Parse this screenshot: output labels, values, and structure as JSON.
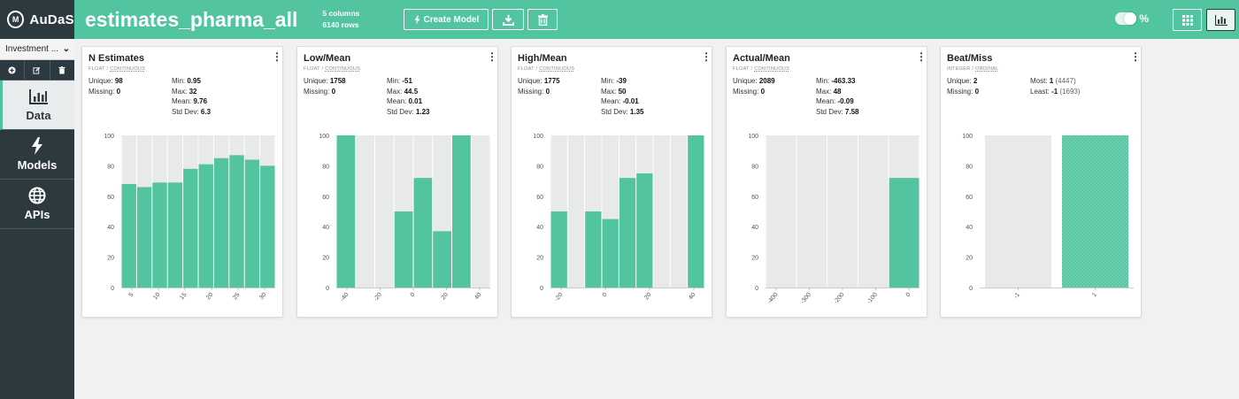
{
  "app": {
    "logo_text": "AuDaS",
    "logo_mark": "M",
    "project_name": "Investment ...",
    "nav": [
      {
        "label": "Data"
      },
      {
        "label": "Models"
      },
      {
        "label": "APIs"
      }
    ]
  },
  "header": {
    "dataset_title": "estimates_pharma_all",
    "columns_text": "5 columns",
    "rows_text": "6140 rows",
    "create_model_label": "Create Model",
    "percent_label": "%",
    "toggle_on": true,
    "accent_color": "#52c4a0",
    "sidebar_color": "#2c3a40"
  },
  "cards": [
    {
      "title": "N Estimates",
      "type_main": "FLOAT",
      "type_sub": "CONTINUOUS",
      "stats_left": [
        {
          "label": "Unique:",
          "value": "98"
        },
        {
          "label": "Missing:",
          "value": "0"
        }
      ],
      "stats_right": [
        {
          "label": "Min:",
          "value": "0.95"
        },
        {
          "label": "Max:",
          "value": "32"
        },
        {
          "label": "Mean:",
          "value": "9.76"
        },
        {
          "label": "Std Dev:",
          "value": "6.3"
        }
      ]
    },
    {
      "title": "Low/Mean",
      "type_main": "FLOAT",
      "type_sub": "CONTINUOUS",
      "stats_left": [
        {
          "label": "Unique:",
          "value": "1758"
        },
        {
          "label": "Missing:",
          "value": "0"
        }
      ],
      "stats_right": [
        {
          "label": "Min:",
          "value": "-51"
        },
        {
          "label": "Max:",
          "value": "44.5"
        },
        {
          "label": "Mean:",
          "value": "0.01"
        },
        {
          "label": "Std Dev:",
          "value": "1.23"
        }
      ]
    },
    {
      "title": "High/Mean",
      "type_main": "FLOAT",
      "type_sub": "CONTINUOUS",
      "stats_left": [
        {
          "label": "Unique:",
          "value": "1775"
        },
        {
          "label": "Missing:",
          "value": "0"
        }
      ],
      "stats_right": [
        {
          "label": "Min:",
          "value": "-39"
        },
        {
          "label": "Max:",
          "value": "50"
        },
        {
          "label": "Mean:",
          "value": "-0.01"
        },
        {
          "label": "Std Dev:",
          "value": "1.35"
        }
      ]
    },
    {
      "title": "Actual/Mean",
      "type_main": "FLOAT",
      "type_sub": "CONTINUOUS",
      "stats_left": [
        {
          "label": "Unique:",
          "value": "2089"
        },
        {
          "label": "Missing:",
          "value": "0"
        }
      ],
      "stats_right": [
        {
          "label": "Min:",
          "value": "-463.33"
        },
        {
          "label": "Max:",
          "value": "48"
        },
        {
          "label": "Mean:",
          "value": "-0.09"
        },
        {
          "label": "Std Dev:",
          "value": "7.58"
        }
      ]
    },
    {
      "title": "Beat/Miss",
      "type_main": "INTEGER",
      "type_sub": "ORDINAL",
      "stats_left": [
        {
          "label": "Unique:",
          "value": "2"
        },
        {
          "label": "Missing:",
          "value": "0"
        }
      ],
      "stats_right": [
        {
          "label": "Most:",
          "value": "1",
          "extra": "(4447)"
        },
        {
          "label": "Least:",
          "value": "-1",
          "extra": "(1693)"
        }
      ]
    }
  ],
  "chart_data": [
    {
      "type": "bar",
      "ylim": [
        0,
        100
      ],
      "yticks": [
        "100",
        "80",
        "60",
        "40",
        "20",
        "0"
      ],
      "xticks": [
        "5",
        "10",
        "15",
        "20",
        "25",
        "30"
      ],
      "bar_color": "#52c4a0",
      "background_bar_color": "#e8eaea",
      "values": [
        68,
        66,
        69,
        69,
        78,
        81,
        85,
        87,
        84,
        80
      ]
    },
    {
      "type": "bar",
      "ylim": [
        0,
        100
      ],
      "yticks": [
        "100",
        "80",
        "60",
        "40",
        "20",
        "0"
      ],
      "xticks": [
        "-40",
        "-20",
        "0",
        "20",
        "40"
      ],
      "bar_color": "#52c4a0",
      "background_bar_color": "#e8eaea",
      "values": [
        100,
        0,
        0,
        50,
        72,
        37,
        100,
        0
      ]
    },
    {
      "type": "bar",
      "ylim": [
        0,
        100
      ],
      "yticks": [
        "100",
        "80",
        "60",
        "40",
        "20",
        "0"
      ],
      "xticks": [
        "-20",
        "0",
        "20",
        "40"
      ],
      "bar_color": "#52c4a0",
      "background_bar_color": "#e8eaea",
      "values": [
        50,
        0,
        50,
        45,
        72,
        75,
        0,
        0,
        100
      ]
    },
    {
      "type": "bar",
      "ylim": [
        0,
        100
      ],
      "yticks": [
        "100",
        "80",
        "60",
        "40",
        "20",
        "0"
      ],
      "xticks": [
        "-400",
        "-300",
        "-200",
        "-100",
        "0"
      ],
      "bar_color": "#52c4a0",
      "background_bar_color": "#e8eaea",
      "values": [
        0,
        0,
        0,
        0,
        72
      ]
    },
    {
      "type": "bar",
      "ylim": [
        0,
        100
      ],
      "yticks": [
        "100",
        "80",
        "60",
        "40",
        "20",
        "0"
      ],
      "categories": [
        "-1",
        "1"
      ],
      "bar_color": "#52c4a0",
      "background_bar_color": "#e8eaea",
      "values": [
        0,
        100
      ]
    }
  ]
}
